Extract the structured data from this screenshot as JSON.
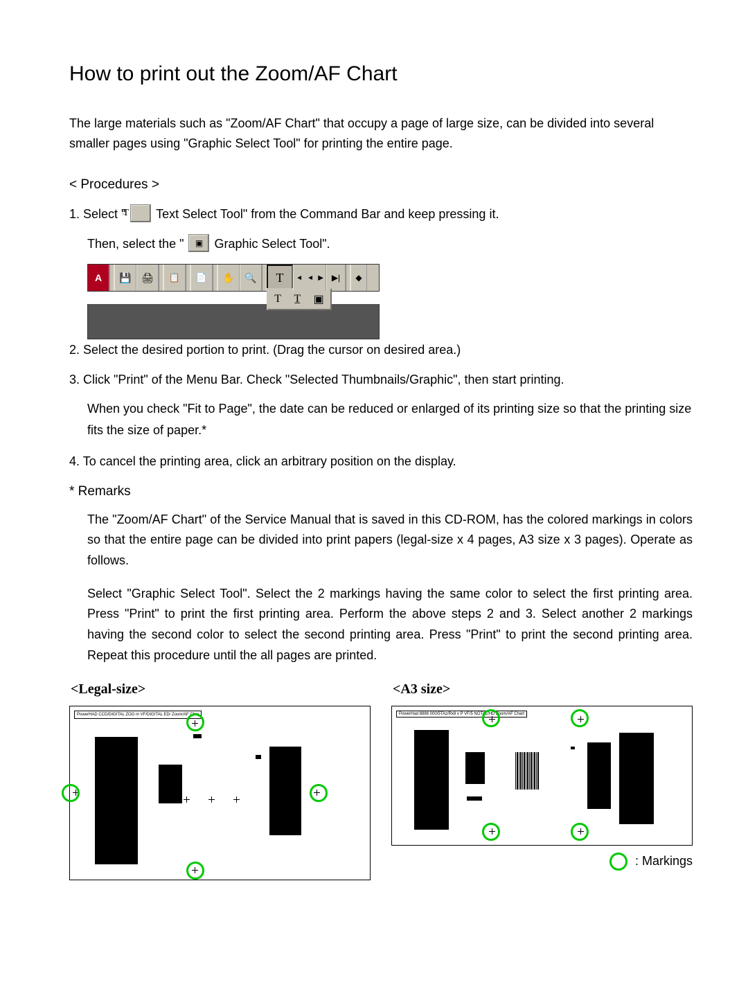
{
  "title": "How to print out the Zoom/AF Chart",
  "intro": "The large materials such as \"Zoom/AF Chart\" that occupy a page of large size, can be divided into several smaller pages using \"Graphic Select Tool\" for printing the entire page.",
  "procedures_title": "< Procedures >",
  "steps": {
    "s1a": "1.  Select  \"",
    "s1b": " Text Select Tool\" from the Command Bar and keep pressing it.",
    "s1c": "Then, select the \"",
    "s1d": " Graphic Select Tool\".",
    "s2": "2.  Select the desired portion to print. (Drag the cursor on desired area.)",
    "s3a": "3.  Click \"Print\" of the Menu Bar. Check \"Selected Thumbnails/Graphic\",  then start printing.",
    "s3b": "When you check \"Fit to Page\", the date can be reduced or enlarged of its printing size so that the printing size fits the size of paper.*",
    "s4": "4.  To cancel the printing area, click an arbitrary position on the display."
  },
  "remarks_title": "*  Remarks",
  "remarks": {
    "p1": "The \"Zoom/AF Chart\" of the Service Manual that is saved in this CD-ROM, has the colored markings in colors so that the entire page can be divided into print papers (legal-size x 4 pages, A3 size x 3 pages). Operate as follows.",
    "p2": "Select \"Graphic Select Tool\". Select the 2 markings having the same color to select the first printing area. Press \"Print\" to print the first printing area. Perform the above steps 2 and 3. Select another 2 markings having the second color to select the second printing area. Press \"Print\" to print the second printing area. Repeat this procedure until the all pages are printed."
  },
  "figures": {
    "legal_title": "<Legal-size>",
    "a3_title": "<A3 size>",
    "legal_header": "PowerHAD CCD/DIGITAL ZOO m\nVF/DIGITAL ED/ Zoom/AF Char",
    "a3_header": "PowerHad 8886 000/5TAz/Rx8 v P VF/5 NOTAL/HD  Zoom/AF Chart"
  },
  "legend_label": ": Markings",
  "toolbar_icons": [
    "adobe-logo-icon",
    "save-icon",
    "print-icon",
    "clipboard-icon",
    "copy-icon",
    "hand-icon",
    "zoom-icon",
    "text-select-icon",
    "next-icon",
    "back-icon"
  ],
  "dropdown_icons": [
    "text-select-sub-icon",
    "text-column-icon",
    "graphic-select-icon"
  ]
}
